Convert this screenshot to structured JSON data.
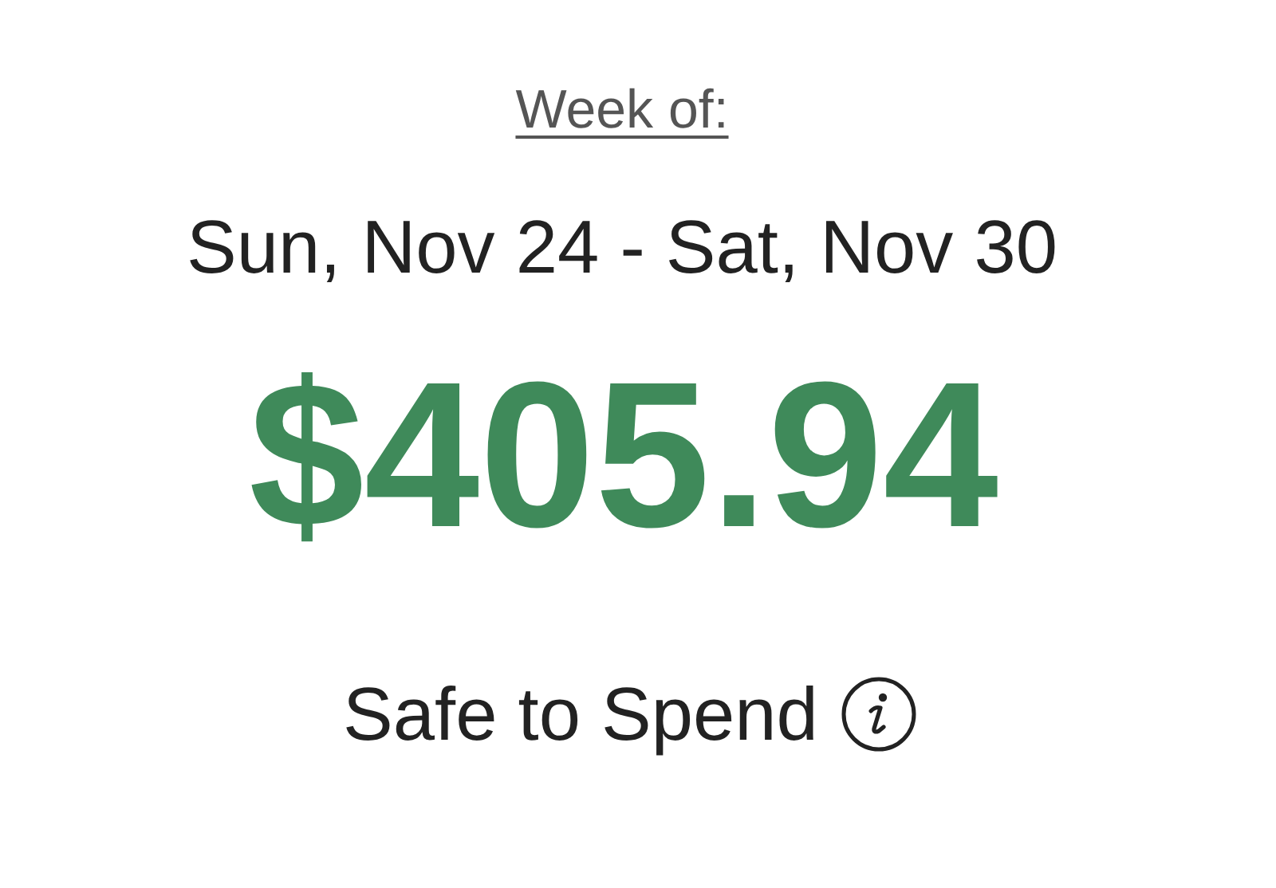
{
  "week_label": "Week of:",
  "date_range": "Sun, Nov 24 - Sat, Nov 30",
  "amount": "$405.94",
  "amount_label": "Safe to Spend"
}
